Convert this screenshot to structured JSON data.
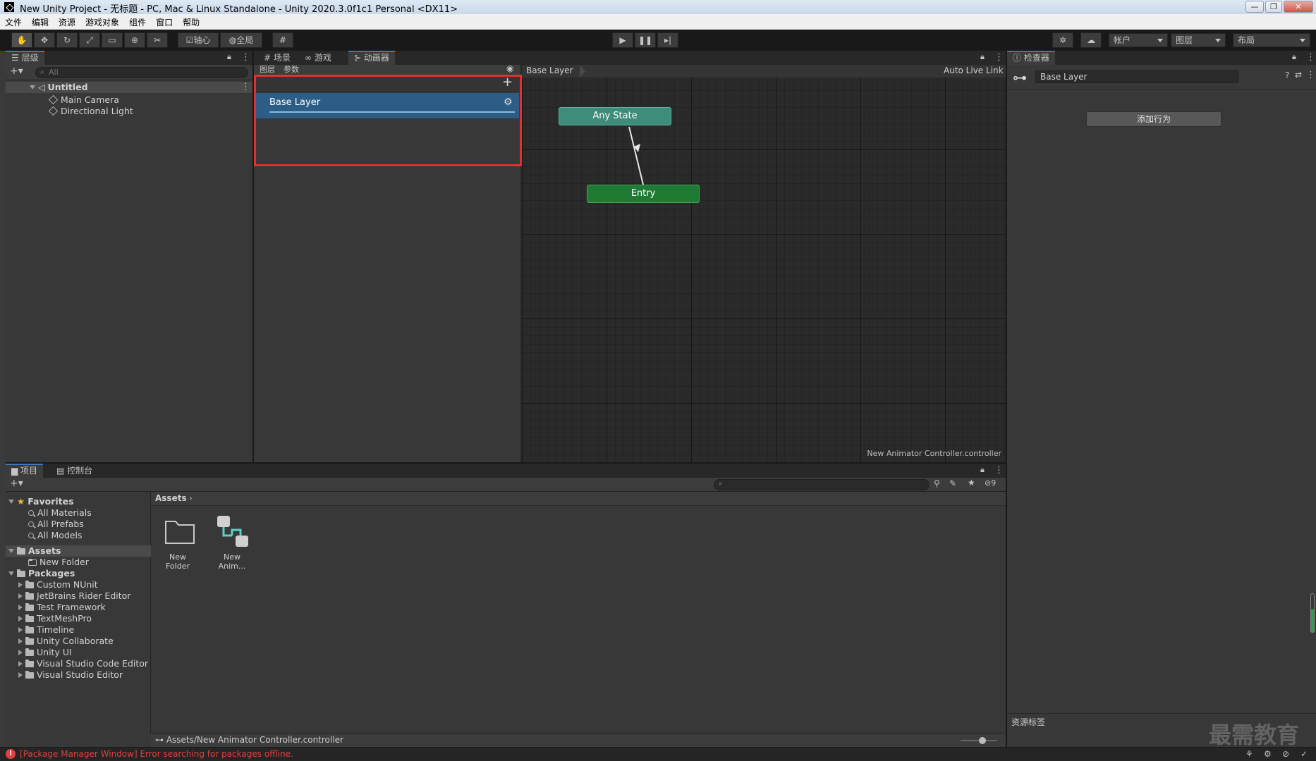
{
  "window": {
    "title": "New Unity Project - 无标题 - PC, Mac & Linux Standalone - Unity 2020.3.0f1c1 Personal <DX11>"
  },
  "menu": [
    "文件",
    "编辑",
    "资源",
    "游戏对象",
    "组件",
    "窗口",
    "帮助"
  ],
  "toolbar": {
    "pivot_label": "轴心",
    "global_label": "全局",
    "account_label": "帐户",
    "layers_label": "图层",
    "layout_label": "布局"
  },
  "hierarchy": {
    "tab_label": "层级",
    "search_placeholder": "All",
    "scene_name": "Untitled",
    "objects": [
      "Main Camera",
      "Directional Light"
    ]
  },
  "center_tabs": [
    "场景",
    "游戏",
    "动画器"
  ],
  "animator": {
    "subtabs": [
      "图层",
      "参数"
    ],
    "layers": [
      {
        "name": "Base Layer"
      }
    ],
    "breadcrumb": "Base Layer",
    "auto_live_link": "Auto Live Link",
    "nodes": {
      "any_state": "Any State",
      "entry": "Entry"
    },
    "footer_path": "New Animator Controller.controller"
  },
  "inspector": {
    "tab_label": "检查器",
    "object_name": "Base Layer",
    "add_behaviour": "添加行为",
    "asset_labels": "资源标签",
    "watermark": "最需教育"
  },
  "project": {
    "tabs": [
      "项目",
      "控制台"
    ],
    "favorites_label": "Favorites",
    "favorites": [
      "All Materials",
      "All Prefabs",
      "All Models"
    ],
    "assets_label": "Assets",
    "assets_children": [
      "New Folder"
    ],
    "packages_label": "Packages",
    "packages": [
      "Custom NUnit",
      "JetBrains Rider Editor",
      "Test Framework",
      "TextMeshPro",
      "Timeline",
      "Unity Collaborate",
      "Unity UI",
      "Visual Studio Code Editor",
      "Visual Studio Editor"
    ],
    "breadcrumb": "Assets",
    "grid_items": [
      {
        "name": "New Folder",
        "icon": "folder-icon"
      },
      {
        "name": "New Anim...",
        "icon": "animator-controller-icon"
      }
    ],
    "hidden_count": "9",
    "selected_path": "Assets/New Animator Controller.controller"
  },
  "status": {
    "error_message": "[Package Manager Window] Error searching for packages offline."
  },
  "colors": {
    "accent": "#3a79bb",
    "selection": "#2c5d87",
    "any_state_node": "#3e8c7a",
    "entry_node": "#1f7a34",
    "highlight_border": "#e03030",
    "error": "#e04040"
  }
}
